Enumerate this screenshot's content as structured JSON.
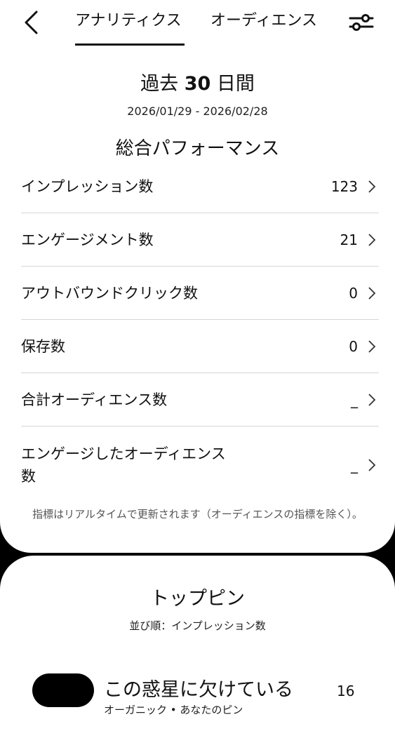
{
  "header": {
    "tabs": [
      {
        "label": "アナリティクス",
        "active": true
      },
      {
        "label": "オーディエンス",
        "active": false
      }
    ]
  },
  "period": {
    "prefix": "過去",
    "days": "30",
    "suffix": "日間",
    "date_range": "2026/01/29 - 2026/02/28"
  },
  "performance": {
    "title": "総合パフォーマンス",
    "metrics": [
      {
        "label": "インプレッション数",
        "value": "123"
      },
      {
        "label": "エンゲージメント数",
        "value": "21"
      },
      {
        "label": "アウトバウンドクリック数",
        "value": "0"
      },
      {
        "label": "保存数",
        "value": "0"
      },
      {
        "label": "合計オーディエンス数",
        "value": "_"
      },
      {
        "label": "エンゲージしたオーディエンス数",
        "value": "_"
      }
    ],
    "footnote": "指標はリアルタイムで更新されます（オーディエンスの指標を除く）。"
  },
  "top_pins": {
    "title": "トップピン",
    "sort_label": "並び順：インプレッション数",
    "items": [
      {
        "title": "この惑星に欠けている",
        "meta": "オーガニック • あなたのピン",
        "count": "16"
      }
    ]
  },
  "colors": {
    "background": "#000000",
    "card": "#ffffff",
    "text": "#111111",
    "divider": "#d6d6d6",
    "muted": "#555555"
  },
  "icons": {
    "back": "chevron-left-icon",
    "filter": "sliders-icon",
    "row": "chevron-right-icon"
  }
}
